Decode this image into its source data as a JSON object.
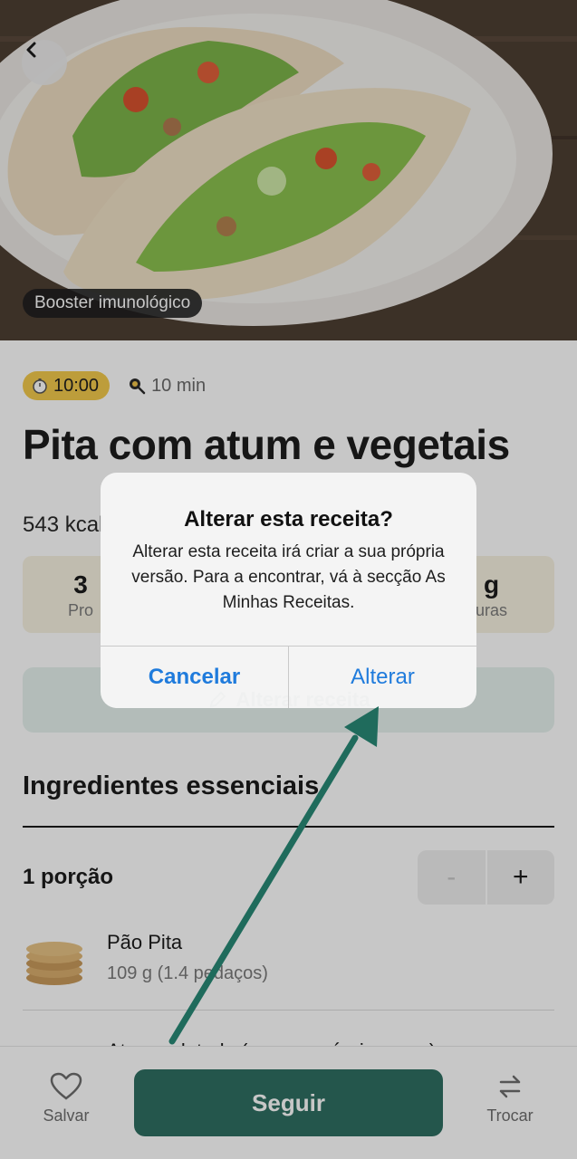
{
  "hero": {
    "tag": "Booster imunológico"
  },
  "recipe": {
    "timer": "10:00",
    "prep_time": "10 min",
    "title": "Pita com atum e vegetais",
    "kcal": "543 kcal",
    "macro_left_value": "3",
    "macro_left_label": "Pro",
    "macro_right_value": "g",
    "macro_right_label": "uras",
    "alter_label": "Alterar receita"
  },
  "ingredients": {
    "section_title": "Ingredientes essenciais",
    "servings": "1 porção",
    "stepper_minus": "-",
    "stepper_plus": "+",
    "items": [
      {
        "name": "Pão Pita",
        "qty": "109 g (1.4 pedaços)"
      },
      {
        "name": "Atum enlatado (no seu próprio sumo)"
      }
    ]
  },
  "bottom": {
    "save_label": "Salvar",
    "follow_label": "Seguir",
    "swap_label": "Trocar"
  },
  "dialog": {
    "title": "Alterar esta receita?",
    "message": "Alterar esta receita irá criar a sua própria versão. Para a encontrar, vá à secção As Minhas Receitas.",
    "cancel_label": "Cancelar",
    "confirm_label": "Alterar"
  },
  "colors": {
    "brand_green": "#2f6f62",
    "timer_yellow": "#f2c94c",
    "dialog_blue": "#1f7bdc",
    "annotation_arrow": "#1f6b5c"
  }
}
